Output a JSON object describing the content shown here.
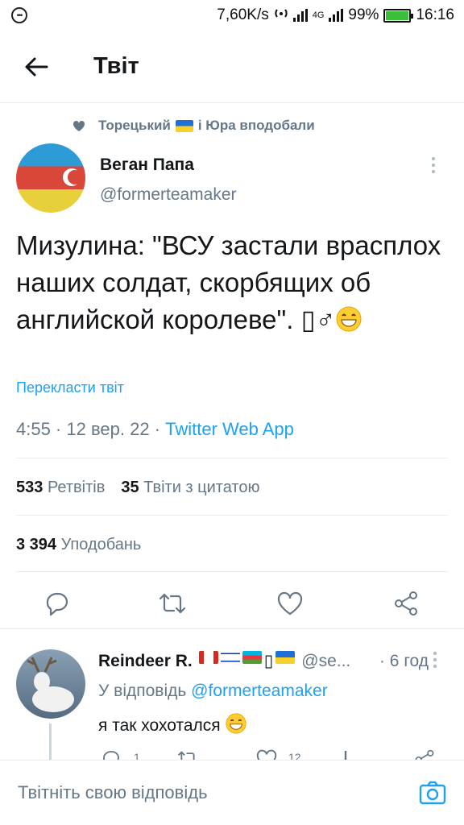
{
  "status_bar": {
    "speed": "7,60K/s",
    "network": "4G",
    "battery": "99%",
    "time": "16:16",
    "battery_level": 0.99
  },
  "header": {
    "title": "Твіт",
    "back_icon": "arrow-left-icon"
  },
  "social_context": {
    "part1": "Торецький",
    "part2": "і Юра вподобали"
  },
  "tweet": {
    "author_name": "Веган Папа",
    "author_handle": "@formerteamaker",
    "text": "Мизулина: \"ВСУ застали врасплох наших солдат, скорбящих об английской королеве\". ",
    "text_tail": "♂",
    "translate_label": "Перекласти твіт",
    "timestamp": "4:55 · 12 вер. 22 · ",
    "source": "Twitter Web App"
  },
  "stats": {
    "retweets_count": "533",
    "retweets_label": "Ретвітів",
    "quotes_count": "35",
    "quotes_label": "Твіти з цитатою",
    "likes_count": "3 394",
    "likes_label": "Уподобань"
  },
  "reply": {
    "name": "Reindeer R.",
    "handle": "@se...",
    "time": "· 6 год",
    "replying_to_prefix": "У відповідь ",
    "replying_to_mention": "@formerteamaker",
    "text": "я так хохотался ",
    "reply_count": "1",
    "like_count": "12"
  },
  "compose": {
    "placeholder": "Твітніть свою відповідь"
  },
  "colors": {
    "accent": "#1da1f2",
    "secondary_text": "#657786",
    "divider": "#e6ecf0"
  }
}
